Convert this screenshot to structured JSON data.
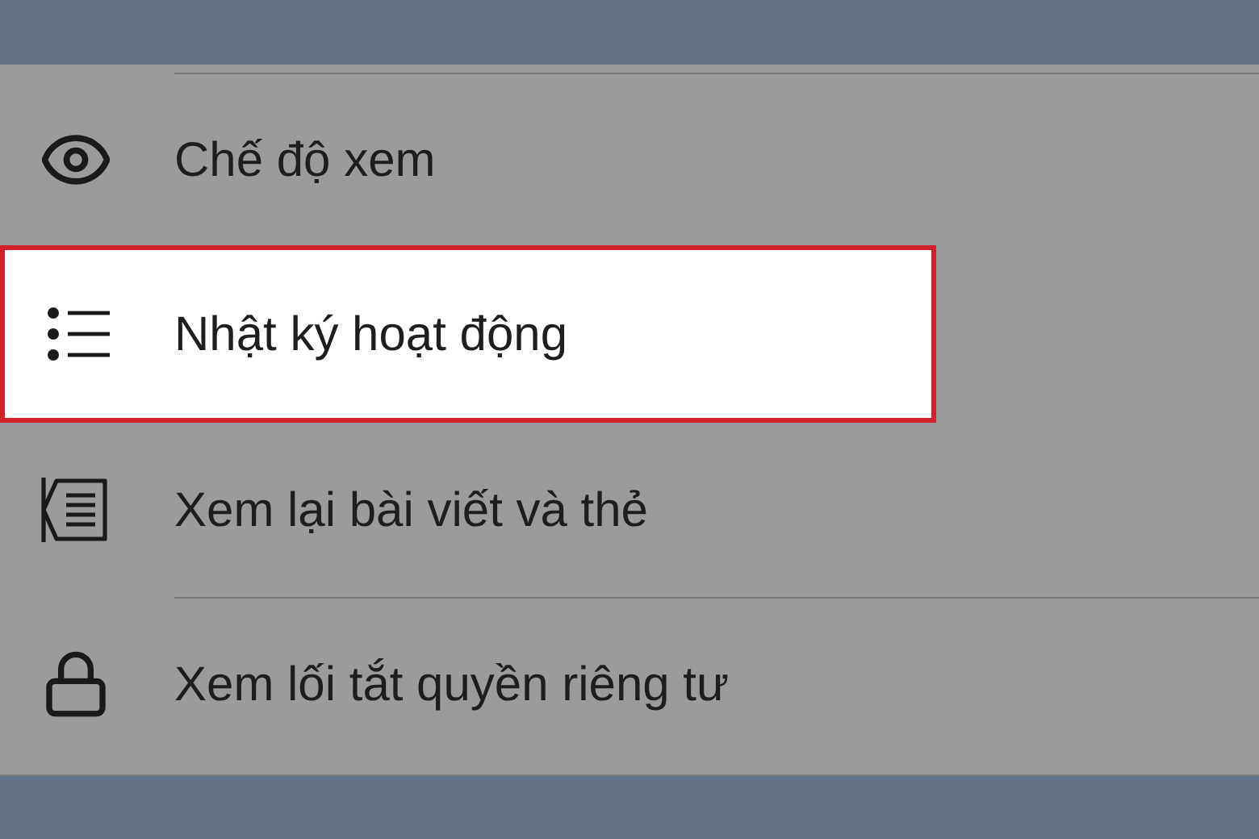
{
  "menu": [
    {
      "kind": "eye",
      "label": "Chế độ xem",
      "selected": false
    },
    {
      "kind": "list",
      "label": "Nhật ký hoạt động",
      "selected": true
    },
    {
      "kind": "review",
      "label": "Xem lại bài viết và thẻ",
      "selected": false
    },
    {
      "kind": "lock",
      "label": "Xem lối tắt quyền riêng tư",
      "selected": false
    }
  ]
}
